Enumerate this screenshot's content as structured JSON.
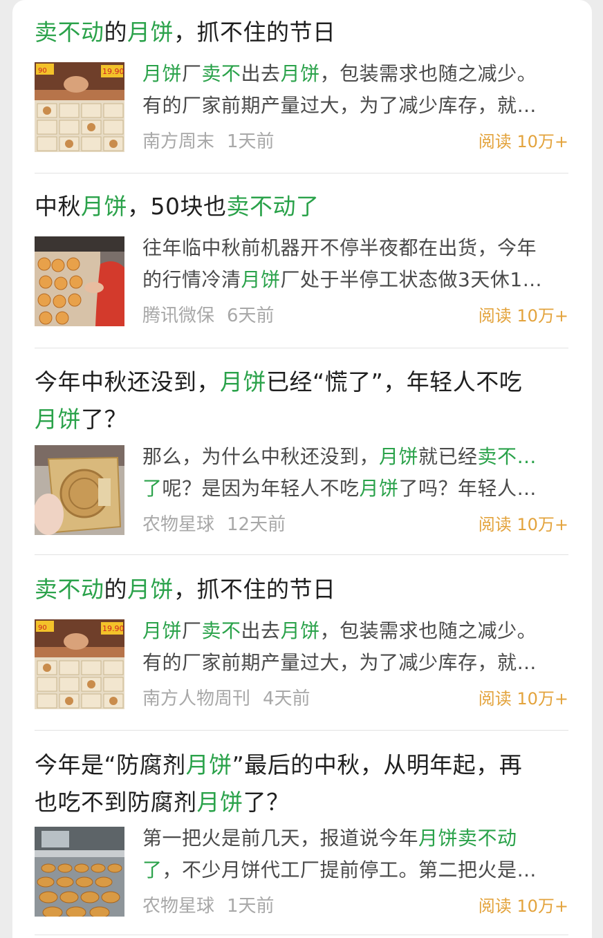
{
  "read_label": "阅读",
  "articles": [
    {
      "title": [
        {
          "t": "卖不动",
          "hl": true
        },
        {
          "t": "的",
          "hl": false
        },
        {
          "t": "月饼",
          "hl": true
        },
        {
          "t": "，抓不住的节日",
          "hl": false
        }
      ],
      "summary": [
        [
          {
            "t": "月饼",
            "hl": true
          },
          {
            "t": "厂",
            "hl": false
          },
          {
            "t": "卖不",
            "hl": true
          },
          {
            "t": "出去",
            "hl": false
          },
          {
            "t": "月饼",
            "hl": true
          },
          {
            "t": "，包装需求也随之减少。",
            "hl": false
          }
        ],
        [
          {
            "t": "有的厂家前期产量过大，为了减少库存，就…",
            "hl": false
          }
        ]
      ],
      "thumb": "mooncake-shelf",
      "source": "南方周末",
      "time": "1天前",
      "reads": "10万+"
    },
    {
      "title": [
        {
          "t": "中秋",
          "hl": false
        },
        {
          "t": "月饼",
          "hl": true
        },
        {
          "t": "，50块也",
          "hl": false
        },
        {
          "t": "卖不动了",
          "hl": true
        }
      ],
      "summary": [
        [
          {
            "t": "往年临中秋前机器开不停半夜都在出货，今年",
            "hl": false
          }
        ],
        [
          {
            "t": "的行情冷清",
            "hl": false
          },
          {
            "t": "月饼",
            "hl": true
          },
          {
            "t": "厂处于半停工状态做3天休1…",
            "hl": false
          }
        ]
      ],
      "thumb": "mooncake-counter",
      "source": "腾讯微保",
      "time": "6天前",
      "reads": "10万+"
    },
    {
      "title": [
        {
          "t": "今年中秋还没到，",
          "hl": false
        },
        {
          "t": "月饼",
          "hl": true
        },
        {
          "t": "已经“慌了”，年轻人不吃",
          "hl": false
        },
        {
          "t": "\n",
          "hl": false
        },
        {
          "t": "月饼",
          "hl": true
        },
        {
          "t": "了？",
          "hl": false
        }
      ],
      "summary": [
        [
          {
            "t": "那么，为什么中秋还没到，",
            "hl": false
          },
          {
            "t": "月饼",
            "hl": true
          },
          {
            "t": "就已经",
            "hl": false
          },
          {
            "t": "卖不…",
            "hl": true
          }
        ],
        [
          {
            "t": "了",
            "hl": true
          },
          {
            "t": "呢？是因为年轻人不吃",
            "hl": false
          },
          {
            "t": "月饼",
            "hl": true
          },
          {
            "t": "了吗？年轻人…",
            "hl": false
          }
        ]
      ],
      "thumb": "mooncake-hand",
      "source": "农物星球",
      "time": "12天前",
      "reads": "10万+"
    },
    {
      "title": [
        {
          "t": "卖不动",
          "hl": true
        },
        {
          "t": "的",
          "hl": false
        },
        {
          "t": "月饼",
          "hl": true
        },
        {
          "t": "，抓不住的节日",
          "hl": false
        }
      ],
      "summary": [
        [
          {
            "t": "月饼",
            "hl": true
          },
          {
            "t": "厂",
            "hl": false
          },
          {
            "t": "卖不",
            "hl": true
          },
          {
            "t": "出去",
            "hl": false
          },
          {
            "t": "月饼",
            "hl": true
          },
          {
            "t": "，包装需求也随之减少。",
            "hl": false
          }
        ],
        [
          {
            "t": "有的厂家前期产量过大，为了减少库存，就…",
            "hl": false
          }
        ]
      ],
      "thumb": "mooncake-shelf",
      "source": "南方人物周刊",
      "time": "4天前",
      "reads": "10万+"
    },
    {
      "title": [
        {
          "t": "今年是“防腐剂",
          "hl": false
        },
        {
          "t": "月饼",
          "hl": true
        },
        {
          "t": "”最后的中秋，从明年起，再",
          "hl": false
        },
        {
          "t": "\n",
          "hl": false
        },
        {
          "t": "也吃不到防腐剂",
          "hl": false
        },
        {
          "t": "月饼",
          "hl": true
        },
        {
          "t": "了？",
          "hl": false
        }
      ],
      "summary": [
        [
          {
            "t": "第一把火是前几天，报道说今年",
            "hl": false
          },
          {
            "t": "月饼卖不动",
            "hl": true
          }
        ],
        [
          {
            "t": "了",
            "hl": true
          },
          {
            "t": "，不少月饼代工厂提前停工。第二把火是…",
            "hl": false
          }
        ]
      ],
      "thumb": "mooncake-factory",
      "source": "农物星球",
      "time": "1天前",
      "reads": "10万+"
    }
  ]
}
